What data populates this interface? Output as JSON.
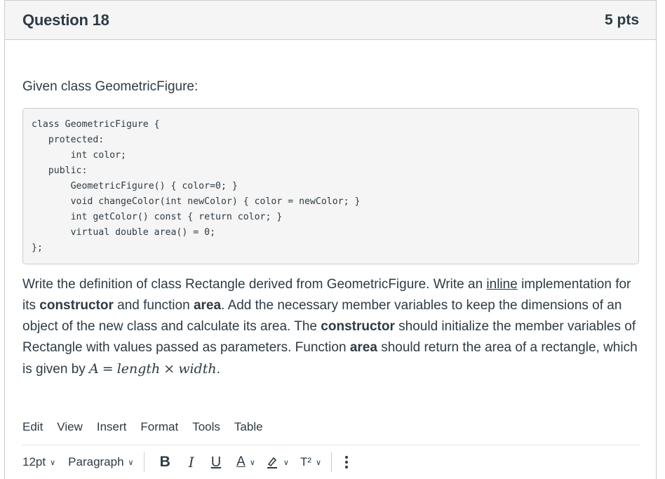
{
  "question": {
    "title": "Question 18",
    "points": "5 pts",
    "intro": "Given class GeometricFigure:",
    "code_lines": [
      "class GeometricFigure {",
      "   protected:",
      "       int color;",
      "   public:",
      "       GeometricFigure() { color=0; }",
      "       void changeColor(int newColor) { color = newColor; }",
      "       int getColor() const { return color; }",
      "       virtual double area() = 0;",
      "};"
    ],
    "description": {
      "p1": "Write the definition of class Rectangle derived from GeometricFigure. Write an ",
      "inline_word": "inline",
      "p2": " implementation for its ",
      "constructor1": "constructor",
      "p3": " and function ",
      "area1": "area",
      "p4": ". Add the necessary member variables to keep the dimensions of an object of the new class and calculate its area. The ",
      "constructor2": "constructor",
      "p5": " should initialize the member variables of Rectangle with values passed as parameters. Function ",
      "area2": "area",
      "p6": " should return the area of a rectangle, which is given by ",
      "math_a": "A",
      "math_eq": "=",
      "math_length": "length",
      "math_times": "×",
      "math_width": "width",
      "p7": "."
    }
  },
  "editor": {
    "menus": [
      "Edit",
      "View",
      "Insert",
      "Format",
      "Tools",
      "Table"
    ],
    "toolbar": {
      "font_size": "12pt",
      "paragraph": "Paragraph",
      "bold": "B",
      "italic": "I",
      "underline": "U",
      "text_color": "A",
      "superscript": "T²"
    }
  }
}
